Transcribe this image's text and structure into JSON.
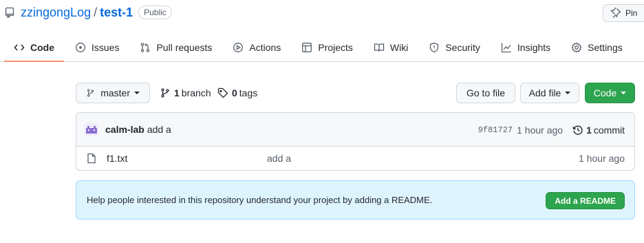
{
  "repo": {
    "owner": "zzingongLog",
    "separator": "/",
    "name": "test-1",
    "visibility": "Public",
    "pin_label": "Pin"
  },
  "tabs": [
    {
      "label": "Code",
      "icon": "code-icon",
      "active": true
    },
    {
      "label": "Issues",
      "icon": "issue-icon"
    },
    {
      "label": "Pull requests",
      "icon": "pull-request-icon"
    },
    {
      "label": "Actions",
      "icon": "play-icon"
    },
    {
      "label": "Projects",
      "icon": "table-icon"
    },
    {
      "label": "Wiki",
      "icon": "book-icon"
    },
    {
      "label": "Security",
      "icon": "shield-icon"
    },
    {
      "label": "Insights",
      "icon": "graph-icon"
    },
    {
      "label": "Settings",
      "icon": "gear-icon"
    }
  ],
  "toolbar": {
    "branch_selector": "master",
    "branch_count": "1",
    "branch_label": "branch",
    "tag_count": "0",
    "tag_label": "tags",
    "go_to_file": "Go to file",
    "add_file": "Add file",
    "code_button": "Code"
  },
  "latest_commit": {
    "author": "calm-lab",
    "message": "add a",
    "sha": "9f81727",
    "age": "1 hour ago",
    "commit_count": "1",
    "commit_label": "commit"
  },
  "files": [
    {
      "name": "f1.txt",
      "message": "add a",
      "age": "1 hour ago",
      "icon": "file-icon"
    }
  ],
  "readme_prompt": {
    "text": "Help people interested in this repository understand your project by adding a README.",
    "button": "Add a README"
  },
  "colors": {
    "link": "#0969da",
    "primary_button": "#2da44e",
    "active_tab_underline": "#fd8c73",
    "readme_banner": "#ddf4ff"
  }
}
